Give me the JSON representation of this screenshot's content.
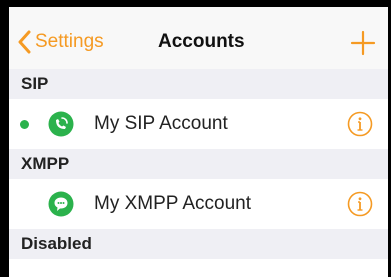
{
  "nav": {
    "back_label": "Settings",
    "title": "Accounts",
    "add_icon": "plus-icon",
    "back_icon": "chevron-left-icon"
  },
  "sections": [
    {
      "header": "SIP",
      "accounts": [
        {
          "name": "My SIP Account",
          "status": "online",
          "icon": "sip-phone-icon"
        }
      ]
    },
    {
      "header": "XMPP",
      "accounts": [
        {
          "name": "My XMPP Account",
          "status": "none",
          "icon": "xmpp-chat-icon"
        }
      ]
    },
    {
      "header": "Disabled",
      "accounts": []
    }
  ],
  "colors": {
    "accent": "#f59a23",
    "account_icon": "#2bb24c",
    "status_online": "#2bb24c",
    "section_bg": "#efeff4"
  }
}
